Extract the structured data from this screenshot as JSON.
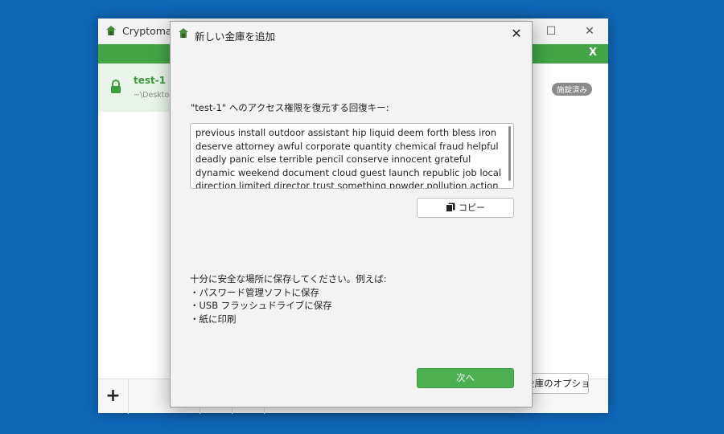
{
  "main_window": {
    "title": "Cryptomator",
    "close_banner": "X",
    "vault": {
      "name": "test-1",
      "path": "~\\Desktop",
      "status": "施錠済み"
    },
    "add_label": "+",
    "vault_options_label": "金庫のオプション"
  },
  "dialog": {
    "title": "新しい金庫を追加",
    "close_label": "✕",
    "prompt": "\"test-1\" へのアクセス権限を復元する回復キー:",
    "recovery_key": "previous install outdoor assistant hip liquid deem forth bless iron deserve attorney awful corporate quantity chemical fraud helpful deadly panic else terrible pencil conserve innocent grateful dynamic weekend document cloud guest launch republic job local direction limited director trust something powder pollution action nervous",
    "copy_label": "コピー",
    "save_intro": "十分に安全な場所に保存してください。例えば:",
    "save_options": [
      "・パスワード管理ソフトに保存",
      "・USB フラッシュドライブに保存",
      "・紙に印刷"
    ],
    "next_label": "次へ"
  },
  "colors": {
    "accent": "#43a546",
    "desktop": "#1067b8"
  }
}
